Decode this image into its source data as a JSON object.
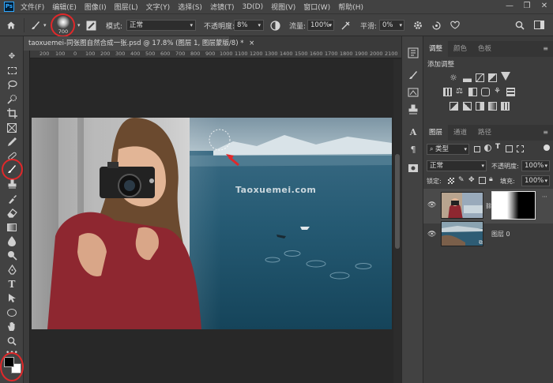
{
  "app": {
    "logo": "Ps"
  },
  "menu": [
    "文件(F)",
    "编辑(E)",
    "图像(I)",
    "图层(L)",
    "文字(Y)",
    "选择(S)",
    "滤镜(T)",
    "3D(D)",
    "视图(V)",
    "窗口(W)",
    "帮助(H)"
  ],
  "window_controls": [
    "—",
    "❐",
    "✕"
  ],
  "options": {
    "brush_size": "700",
    "mode_label": "模式:",
    "mode_value": "正常",
    "opacity_label": "不透明度:",
    "opacity_value": "8%",
    "flow_label": "流量:",
    "flow_value": "100%",
    "smooth_label": "平滑:",
    "smooth_value": "0%"
  },
  "document": {
    "tab_title": "taoxuemei-同张图自然合成一张.psd @ 17.8% (图层 1, 图层蒙版/8) *",
    "tab_close": "×",
    "watermark": "Taoxuemei.com"
  },
  "ruler": {
    "ticks": [
      "200",
      "100",
      "0",
      "100",
      "200",
      "300",
      "400",
      "500",
      "600",
      "700",
      "800",
      "900",
      "1000",
      "1100",
      "1200",
      "1300",
      "1400",
      "1500",
      "1600",
      "1700",
      "1800",
      "1900",
      "2000",
      "2100"
    ]
  },
  "panels": {
    "adjust_tabs": [
      "调整",
      "颜色",
      "色板"
    ],
    "adjust_title": "添加调整",
    "layers_tabs": [
      "图层",
      "通道",
      "路径"
    ],
    "filter_kind": "类型",
    "blend_mode": "正常",
    "opacity_label": "不透明度:",
    "opacity_value": "100%",
    "lock_label": "锁定:",
    "fill_label": "填充:",
    "fill_value": "100%",
    "layer_bg_name": "图层 0"
  },
  "colors": {
    "accent": "#31a8ff",
    "highlight_circle": "#e0282a"
  }
}
